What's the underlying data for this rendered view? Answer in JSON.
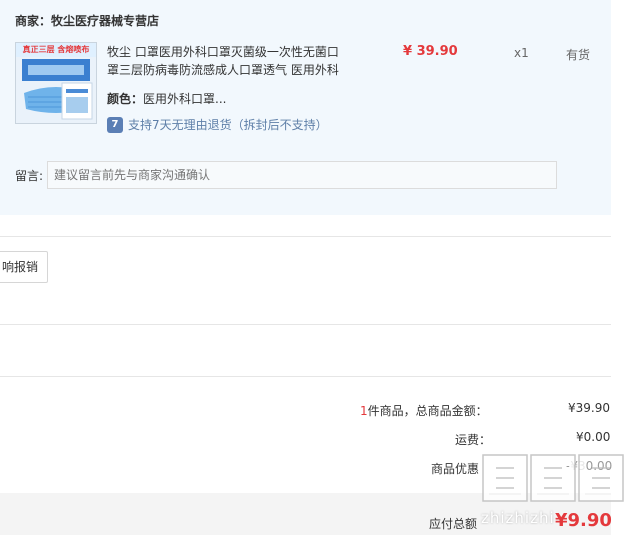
{
  "seller": {
    "label": "商家：",
    "name": "牧尘医疗器械专营店"
  },
  "product": {
    "thumbnail_banner": "真正三层 含熔喷布",
    "title": "牧尘 口罩医用外科口罩灭菌级一次性无菌口罩三层防病毒防流感成人口罩透气 医用外科",
    "price": "¥ 39.90",
    "quantity": "x1",
    "stock": "有货",
    "color_label": "颜色：",
    "color_value": "医用外科口罩...",
    "return_icon": "7",
    "return_policy": "支持7天无理由退货（拆封后不支持）"
  },
  "message": {
    "label": "留言:",
    "placeholder": "建议留言前先与商家沟通确认"
  },
  "invoice": {
    "button_label": "响报销"
  },
  "summary": {
    "count": "1",
    "items_total_label": "件商品，总商品金额：",
    "items_total_value": "¥39.90",
    "shipping_label": "运费：",
    "shipping_value": "¥0.00",
    "discount_label": "商品优惠",
    "discount_value": "-¥30.00",
    "payable_label": "应付总额",
    "payable_value": "¥9.90"
  },
  "watermark": {
    "text": "zhizhizhi",
    "icon": "值-logo-watermark"
  },
  "colors": {
    "accent": "#e4393c",
    "panel_bg": "#f2f8fd",
    "link": "#5e7fa8"
  }
}
